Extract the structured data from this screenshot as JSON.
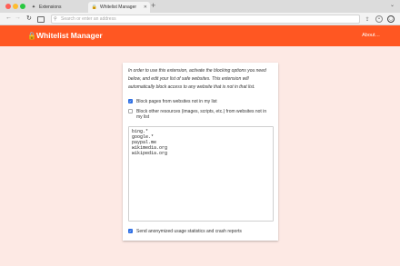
{
  "browser": {
    "tabs": [
      {
        "label": "Extensions",
        "icon": "puzzle-icon"
      },
      {
        "label": "Whitelist Manager",
        "icon": "lock-icon",
        "active": true
      }
    ],
    "address_placeholder": "Search or enter an address"
  },
  "app": {
    "title": "Whitelist Manager",
    "about_label": "About…",
    "accent_color": "#ff5722",
    "background_color": "#fde9e4"
  },
  "settings": {
    "description": "In order to use this extension, activate the blocking options you need below, and edit your list of safe websites. This extension will automatically block access to any website that is not in that list.",
    "option_block_pages": {
      "label": "Block pages from websites not in my list",
      "checked": true
    },
    "option_block_resources": {
      "label": "Block other resources (images, scripts, etc.) from websites not in my list",
      "checked": false
    },
    "whitelist": [
      "bing.*",
      "google.*",
      "paypal.me",
      "wikimedia.org",
      "wikipedia.org"
    ],
    "option_stats": {
      "label": "Send anonymized usage statistics and crash reports",
      "checked": true
    }
  }
}
